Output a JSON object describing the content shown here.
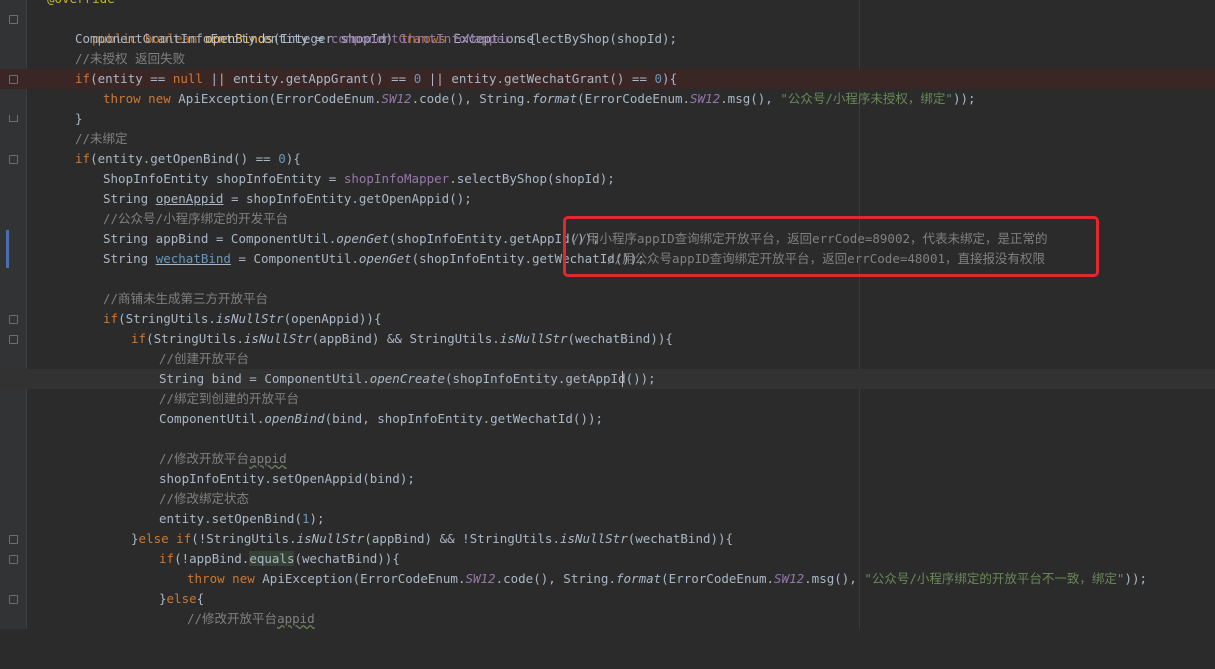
{
  "editor": {
    "lines": [
      {
        "t": "annotation",
        "text": "@Override"
      },
      {
        "t": "method_decl",
        "kw1": "public",
        "kw2": "boolean",
        "name": "openBinds",
        "params": "(Integer shopId) ",
        "throws": "throws",
        "rest": " Exception {"
      },
      {
        "t": "plain",
        "text": "ComponentGrantInfoEntity entity = ",
        "field": "componentGrantInfoMapper",
        "tail": ".selectByShop(shopId);"
      },
      {
        "t": "comment",
        "text": "//未授权 返回失败"
      },
      {
        "t": "if_grant",
        "kw": "if",
        "a": "(entity == ",
        "null": "null",
        "b": " || entity.getAppGrant() == ",
        "n0": "0",
        "c": " || entity.getWechatGrant() == ",
        "n1": "0",
        "d": "){"
      },
      {
        "t": "throw1",
        "kw": "throw",
        "kw2": "new",
        "a": " ApiException(ErrorCodeEnum.",
        "f": "SW12",
        "b": ".code(), String.",
        "m": "format",
        "c": "(ErrorCodeEnum.",
        "f2": "SW12",
        "d": ".msg(), ",
        "s": "\"公众号/小程序未授权，绑定\"",
        "e": "));"
      },
      {
        "t": "plain",
        "text": "}"
      },
      {
        "t": "comment",
        "text": "//未绑定"
      },
      {
        "t": "if_open",
        "kw": "if",
        "a": "(entity.getOpenBind() == ",
        "n": "0",
        "b": "){"
      },
      {
        "t": "plain",
        "text": "ShopInfoEntity shopInfoEntity = ",
        "field": "shopInfoMapper",
        "tail": ".selectByShop(shopId);"
      },
      {
        "t": "appid",
        "a": "String ",
        "v": "openAppid",
        "b": " = shopInfoEntity.getOpenAppid();"
      },
      {
        "t": "comment",
        "text": "//公众号/小程序绑定的开发平台"
      },
      {
        "t": "appbind",
        "a": "String appBind = ComponentUtil.",
        "m": "openGet",
        "b": "(shopInfoEntity.getAppId()); ",
        "c": "//用小程序appID查询绑定开放平台，返回errCode=89002，代表未绑定，是正常的"
      },
      {
        "t": "wechatbind",
        "a": "String ",
        "v": "wechatBind",
        "b": " = ComponentUtil.",
        "m": "openGet",
        "c": "(shopInfoEntity.getWechatId());",
        "d": "//用公众号appID查询绑定开放平台，返回errCode=48001，直接报没有权限"
      },
      {
        "t": "blank",
        "text": ""
      },
      {
        "t": "comment",
        "text": "//商铺未生成第三方开放平台"
      },
      {
        "t": "if_null1",
        "kw": "if",
        "a": "(StringUtils.",
        "m": "isNullStr",
        "b": "(openAppid)){"
      },
      {
        "t": "if_null2",
        "kw": "if",
        "a": "(StringUtils.",
        "m": "isNullStr",
        "b": "(appBind) && StringUtils.",
        "m2": "isNullStr",
        "c": "(wechatBind)){"
      },
      {
        "t": "comment",
        "text": "//创建开放平台"
      },
      {
        "t": "create",
        "a": "String bind = ComponentUtil.",
        "m": "openCreate",
        "b": "(shopInfoEntity.getAppId());"
      },
      {
        "t": "comment",
        "text": "//绑定到创建的开放平台"
      },
      {
        "t": "openbind",
        "a": "ComponentUtil.",
        "m": "openBind",
        "b": "(bind, shopInfoEntity.getWechatId());"
      },
      {
        "t": "blank",
        "text": ""
      },
      {
        "t": "comment_w",
        "a": "//修改开放平台",
        "w": "appid"
      },
      {
        "t": "plain",
        "text": "shopInfoEntity.setOpenAppid(bind);"
      },
      {
        "t": "comment",
        "text": "//修改绑定状态"
      },
      {
        "t": "setbind",
        "a": "entity.setOpenBind(",
        "n": "1",
        "b": ");"
      },
      {
        "t": "elseif",
        "a": "}",
        "kw1": "else",
        "kw2": " if",
        "b": "(!StringUtils.",
        "m": "isNullStr",
        "c": "(appBind) && !StringUtils.",
        "m2": "isNullStr",
        "d": "(wechatBind)){"
      },
      {
        "t": "ifequals",
        "kw": "if",
        "a": "(!appBind.",
        "m": "equals",
        "b": "(wechatBind)){"
      },
      {
        "t": "throw2",
        "kw": "throw",
        "kw2": "new",
        "a": " ApiException(ErrorCodeEnum.",
        "f": "SW12",
        "b": ".code(), String.",
        "m": "format",
        "c": "(ErrorCodeEnum.",
        "f2": "SW12",
        "d": ".msg(), ",
        "s": "\"公众号/小程序绑定的开放平台不一致，绑定\"",
        "e": "));"
      },
      {
        "t": "else",
        "a": "}",
        "kw": "else",
        "b": "{"
      },
      {
        "t": "comment_w",
        "a": "//修改开放平台",
        "w": "appid"
      }
    ]
  },
  "colors": {
    "background": "#2b2b2b",
    "keyword": "#cc7832",
    "callout_border": "#e1282d"
  }
}
